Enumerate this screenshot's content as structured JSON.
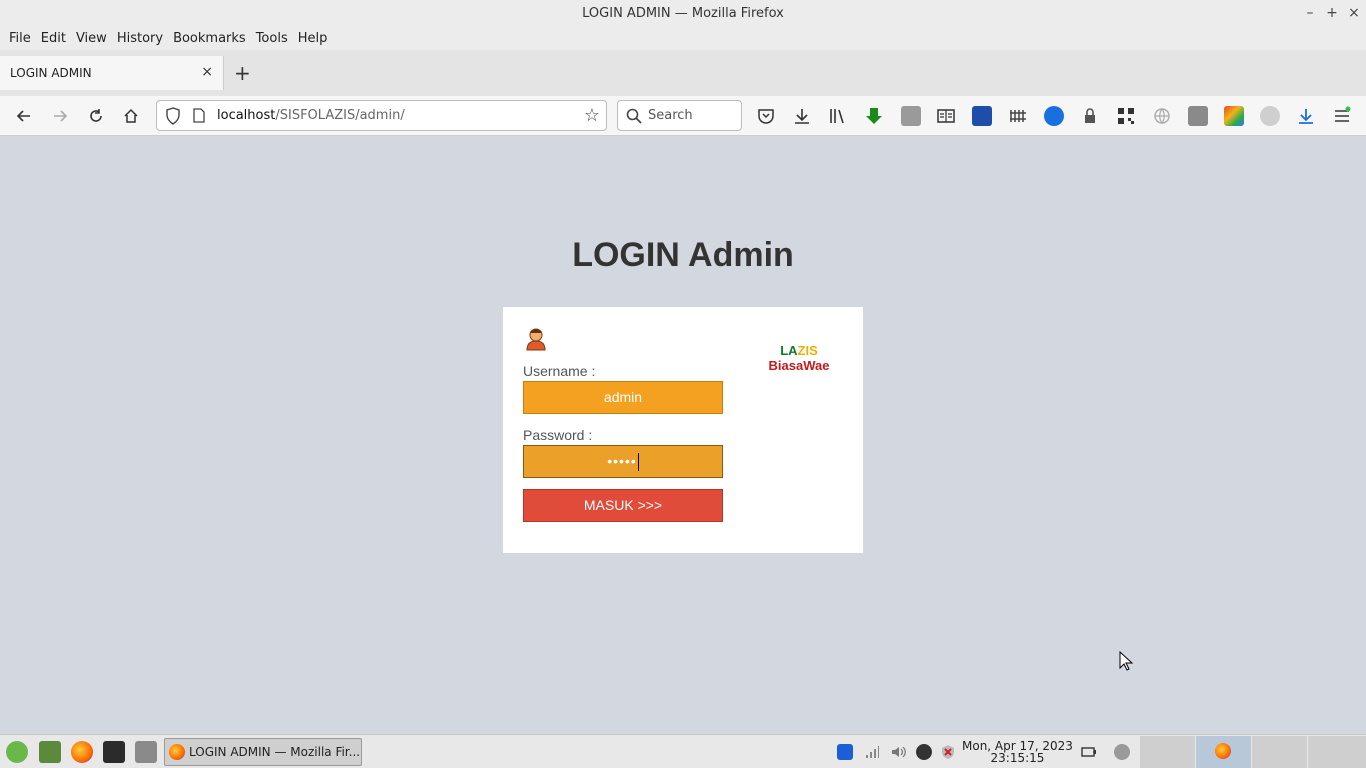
{
  "window": {
    "title": "LOGIN ADMIN — Mozilla Firefox",
    "controls": [
      "–",
      "+",
      "×"
    ]
  },
  "menubar": [
    "File",
    "Edit",
    "View",
    "History",
    "Bookmarks",
    "Tools",
    "Help"
  ],
  "tabs": [
    {
      "label": "LOGIN ADMIN",
      "close": "×"
    }
  ],
  "new_tab_label": "+",
  "navbar": {
    "url_host": "localhost",
    "url_path": "/SISFOLAZIS/admin/",
    "search_placeholder": "Search"
  },
  "page": {
    "title": "LOGIN Admin",
    "username_label": "Username :",
    "username_value": "admin",
    "password_label": "Password :",
    "password_value": "•••••",
    "submit_label": "MASUK >>>",
    "logo": {
      "part1": "LA",
      "part2": "ZIS",
      "line2": "BiasaWae"
    }
  },
  "taskbar": {
    "window_label": "LOGIN ADMIN — Mozilla Fir...",
    "clock_date": "Mon, Apr 17, 2023",
    "clock_time": "23:15:15"
  },
  "colors": {
    "page_bg": "#d3d7df",
    "field_orange": "#f4a020",
    "button_red": "#e04b3a"
  }
}
